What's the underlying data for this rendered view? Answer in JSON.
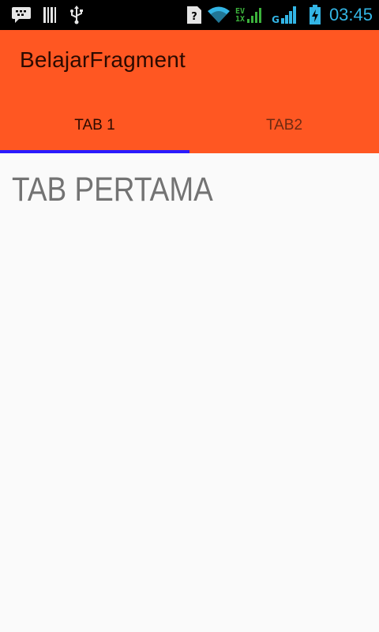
{
  "status_bar": {
    "time": "03:45",
    "network_label_top": "EV",
    "network_label_bottom": "1X",
    "signal_label": "G",
    "clock_color": "#33B5E5",
    "icons_left": [
      "bbm-chat-icon",
      "barcode-icon",
      "usb-icon"
    ],
    "icons_right": [
      "sim-unknown-icon",
      "wifi-icon",
      "ev-1x-signal-icon",
      "cell-signal-icon",
      "battery-charging-icon"
    ]
  },
  "app_bar": {
    "title": "BelajarFragment",
    "color": "#FF5722"
  },
  "tabs": [
    {
      "label": "TAB 1",
      "selected": true
    },
    {
      "label": "TAB2",
      "selected": false
    }
  ],
  "tab_indicator_color": "#2A1AFF",
  "content": {
    "heading": "TAB PERTAMA"
  }
}
